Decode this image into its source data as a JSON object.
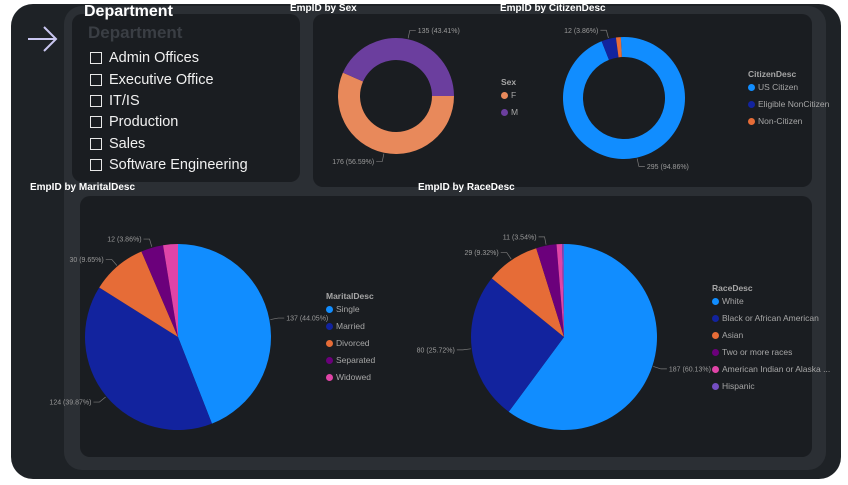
{
  "slicer": {
    "title": "Department",
    "ghost_title": "Department",
    "options": [
      "Admin Offices",
      "Executive Office",
      "IT/IS",
      "Production",
      "Sales",
      "Software Engineering"
    ]
  },
  "chart_data": [
    {
      "type": "donut",
      "title": "EmpID by Sex",
      "legend_title": "Sex",
      "legend_placement": "right",
      "categories": [
        "F",
        "M"
      ],
      "values": [
        176,
        135
      ],
      "percents": [
        "56.59%",
        "43.41%"
      ],
      "colors": [
        "#e8895b",
        "#6b3e9e"
      ],
      "data_labels": [
        "176 (56.59%)",
        "135 (43.41%)"
      ]
    },
    {
      "type": "donut",
      "title": "EmpID by CitizenDesc",
      "legend_title": "CitizenDesc",
      "legend_placement": "right",
      "categories": [
        "US Citizen",
        "Eligible NonCitizen",
        "Non-Citizen"
      ],
      "values": [
        295,
        12,
        4
      ],
      "percents": [
        "94.86%",
        "3.86%",
        "1.29%"
      ],
      "colors": [
        "#118dff",
        "#12239e",
        "#e66c37"
      ],
      "data_labels": [
        "295 (94.86%)",
        "12 (3.86%)",
        ""
      ]
    },
    {
      "type": "pie",
      "title": "EmpID by MaritalDesc",
      "legend_title": "MaritalDesc",
      "legend_placement": "right",
      "categories": [
        "Single",
        "Married",
        "Divorced",
        "Separated",
        "Widowed"
      ],
      "values": [
        137,
        124,
        30,
        12,
        8
      ],
      "percents": [
        "44.05%",
        "39.87%",
        "9.65%",
        "3.86%",
        "2.57%"
      ],
      "colors": [
        "#118dff",
        "#12239e",
        "#e66c37",
        "#6b007b",
        "#e044a7"
      ],
      "data_labels": [
        "137 (44.05%)",
        "124 (39.87%)",
        "30 (9.65%)",
        "12 (3.86%)",
        ""
      ]
    },
    {
      "type": "pie",
      "title": "EmpID by RaceDesc",
      "legend_title": "RaceDesc",
      "legend_placement": "right",
      "categories": [
        "White",
        "Black or African American",
        "Asian",
        "Two or more races",
        "American Indian or Alaska ...",
        "Hispanic"
      ],
      "values": [
        187,
        80,
        29,
        11,
        3,
        1
      ],
      "percents": [
        "60.13%",
        "25.72%",
        "9.32%",
        "3.54%",
        "0.96%",
        "0.32%"
      ],
      "colors": [
        "#118dff",
        "#12239e",
        "#e66c37",
        "#6b007b",
        "#e044a7",
        "#744ec2"
      ],
      "data_labels": [
        "187 (60.13%)",
        "80 (25.72%)",
        "29 (9.32%)",
        "11 (3.54%)",
        "",
        ""
      ]
    }
  ]
}
